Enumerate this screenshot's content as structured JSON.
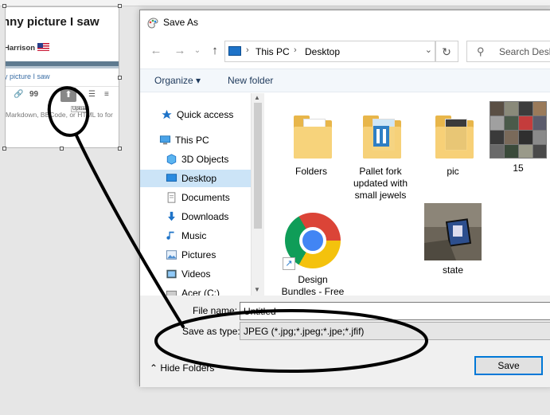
{
  "forum_snippet": {
    "title": "nny picture I saw",
    "author": "Harrison",
    "breadcrumb_link": "y picture I saw",
    "toolbar_link_icon": "🔗",
    "toolbar_quote_icon": "99",
    "upload_tooltip": "Upload",
    "hint_text": "Markdown, BBCode, or HTML to for",
    "list_icon": "☰"
  },
  "dialog": {
    "title": "Save As",
    "address": {
      "root": "This PC",
      "folder": "Desktop"
    },
    "search_placeholder": "Search Desktop",
    "commands": {
      "organize": "Organize ▾",
      "new_folder": "New folder"
    },
    "nav_items": [
      {
        "label": "Quick access",
        "icon": "star-icon"
      },
      {
        "label": "This PC",
        "icon": "computer-icon"
      },
      {
        "label": "3D Objects",
        "icon": "cube-icon"
      },
      {
        "label": "Desktop",
        "icon": "desktop-icon",
        "selected": true
      },
      {
        "label": "Documents",
        "icon": "document-icon"
      },
      {
        "label": "Downloads",
        "icon": "download-icon"
      },
      {
        "label": "Music",
        "icon": "music-icon"
      },
      {
        "label": "Pictures",
        "icon": "pictures-icon"
      },
      {
        "label": "Videos",
        "icon": "video-icon"
      },
      {
        "label": "Acer (C:)",
        "icon": "drive-icon"
      }
    ],
    "files": [
      {
        "name": "Folders",
        "kind": "folder"
      },
      {
        "name": "Pallet fork updated with small jewels",
        "kind": "folder"
      },
      {
        "name": "pic",
        "kind": "folder"
      },
      {
        "name": "15",
        "kind": "image"
      },
      {
        "name": "Design Bundles - Free and",
        "kind": "shortcut"
      },
      {
        "name": "state",
        "kind": "image"
      }
    ],
    "file_name_label": "File name:",
    "file_name_value": "Untitled",
    "save_type_label": "Save as type:",
    "save_type_value": "JPEG (*.jpg;*.jpeg;*.jpe;*.jfif)",
    "hide_folders": "Hide Folders",
    "save_button": "Save"
  },
  "colors": {
    "selection": "#cce4f7",
    "accent": "#0078d7",
    "folder": "#e8b64a"
  }
}
